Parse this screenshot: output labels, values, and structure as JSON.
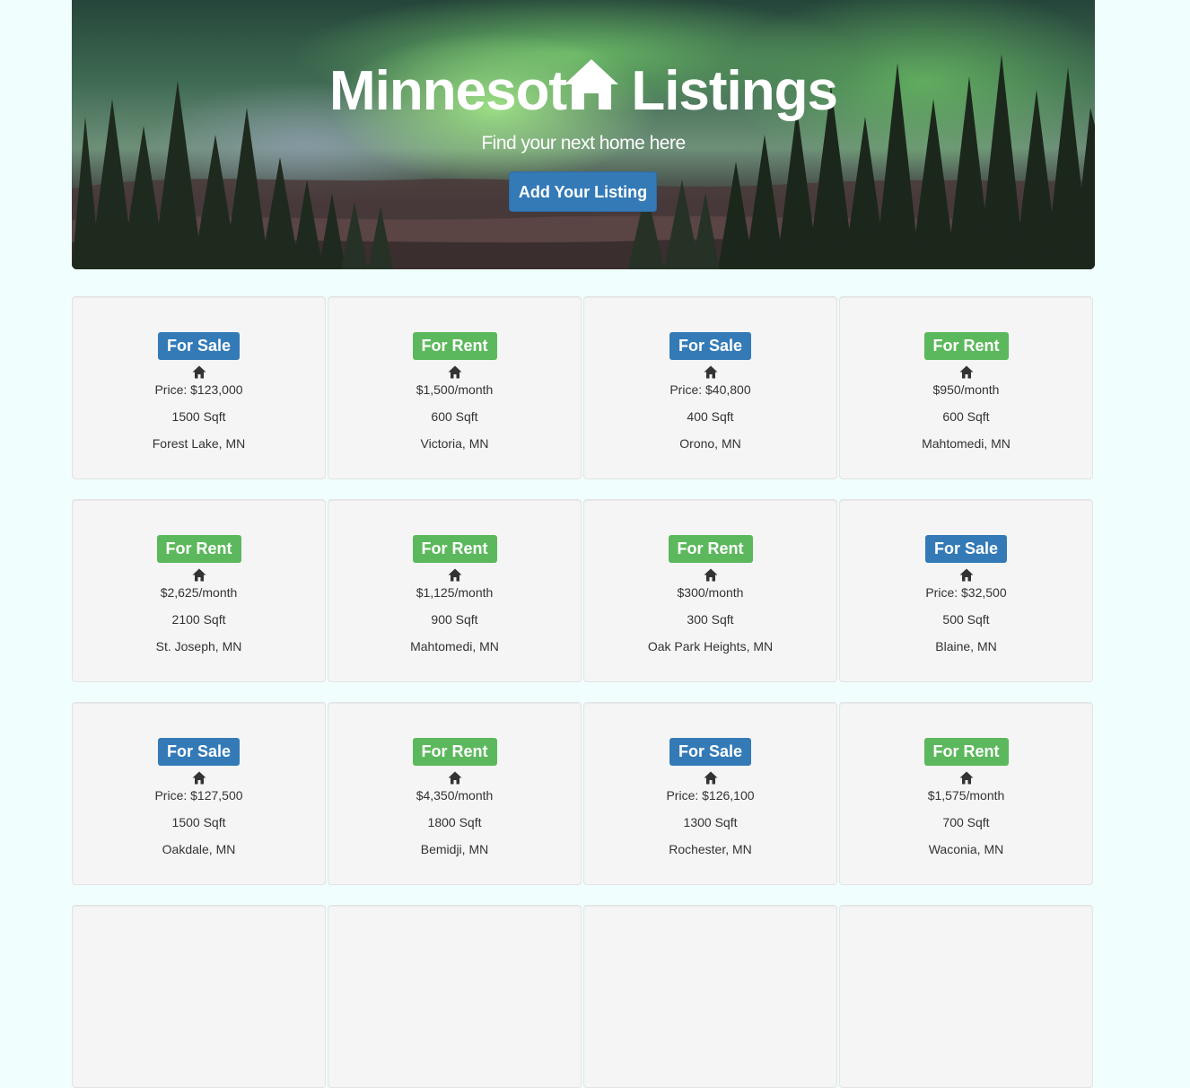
{
  "hero": {
    "title_before": "Minnesot",
    "title_after": "Listings",
    "subtitle": "Find your next home here",
    "add_button": "Add Your Listing"
  },
  "colors": {
    "for_sale": "#337ab7",
    "for_rent": "#5cb85c",
    "page_bg": "#f0fffe",
    "card_bg": "#f5f5f5"
  },
  "listings": [
    {
      "status": "For Sale",
      "type": "sale",
      "price": "Price: $123,000",
      "sqft": "1500 Sqft",
      "location": "Forest Lake, MN"
    },
    {
      "status": "For Rent",
      "type": "rent",
      "price": "$1,500/month",
      "sqft": "600 Sqft",
      "location": "Victoria, MN"
    },
    {
      "status": "For Sale",
      "type": "sale",
      "price": "Price: $40,800",
      "sqft": "400 Sqft",
      "location": "Orono, MN"
    },
    {
      "status": "For Rent",
      "type": "rent",
      "price": "$950/month",
      "sqft": "600 Sqft",
      "location": "Mahtomedi, MN"
    },
    {
      "status": "For Rent",
      "type": "rent",
      "price": "$2,625/month",
      "sqft": "2100 Sqft",
      "location": "St. Joseph, MN"
    },
    {
      "status": "For Rent",
      "type": "rent",
      "price": "$1,125/month",
      "sqft": "900 Sqft",
      "location": "Mahtomedi, MN"
    },
    {
      "status": "For Rent",
      "type": "rent",
      "price": "$300/month",
      "sqft": "300 Sqft",
      "location": "Oak Park Heights, MN"
    },
    {
      "status": "For Sale",
      "type": "sale",
      "price": "Price: $32,500",
      "sqft": "500 Sqft",
      "location": "Blaine, MN"
    },
    {
      "status": "For Sale",
      "type": "sale",
      "price": "Price: $127,500",
      "sqft": "1500 Sqft",
      "location": "Oakdale, MN"
    },
    {
      "status": "For Rent",
      "type": "rent",
      "price": "$4,350/month",
      "sqft": "1800 Sqft",
      "location": "Bemidji, MN"
    },
    {
      "status": "For Sale",
      "type": "sale",
      "price": "Price: $126,100",
      "sqft": "1300 Sqft",
      "location": "Rochester, MN"
    },
    {
      "status": "For Rent",
      "type": "rent",
      "price": "$1,575/month",
      "sqft": "700 Sqft",
      "location": "Waconia, MN"
    }
  ],
  "icons": {
    "title_house": "home-icon",
    "card_house": "home-icon"
  }
}
